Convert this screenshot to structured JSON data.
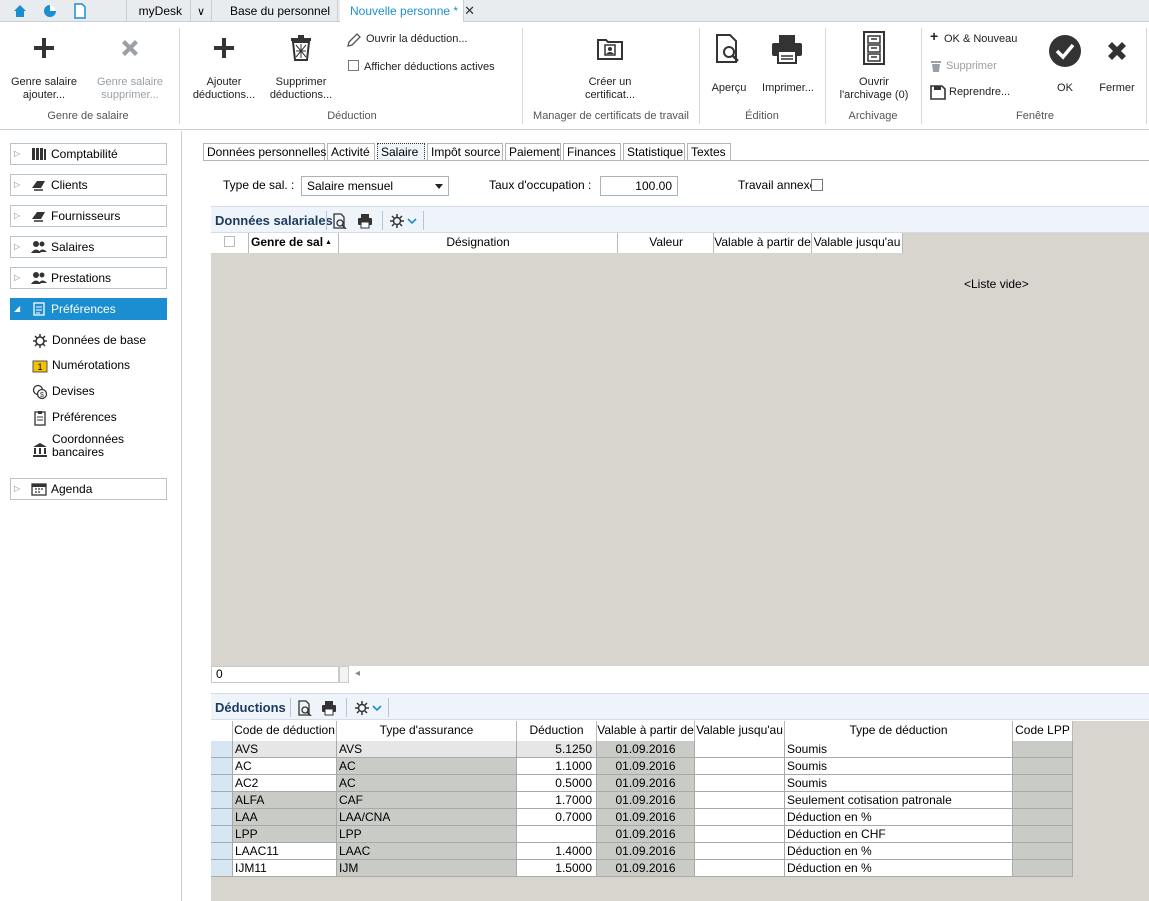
{
  "tabs": {
    "mydesk": "myDesk",
    "base": "Base du personnel",
    "active": "Nouvelle personne *"
  },
  "ribbon": {
    "genre_ajouter": [
      "Genre salaire",
      "ajouter..."
    ],
    "genre_supprimer": [
      "Genre salaire",
      "supprimer..."
    ],
    "group_genre": "Genre de salaire",
    "ajouter_deductions": [
      "Ajouter",
      "déductions..."
    ],
    "supprimer_deductions": [
      "Supprimer",
      "déductions..."
    ],
    "ouvrir_deduction": "Ouvrir la déduction...",
    "afficher_deductions": "Afficher déductions actives",
    "group_deduction": "Déduction",
    "creer_certificat": [
      "Créer un",
      "certificat..."
    ],
    "group_manager": "Manager de certificats de travail",
    "apercu": "Aperçu",
    "imprimer": "Imprimer...",
    "group_edition": "Édition",
    "ouvrir_archivage": [
      "Ouvrir",
      "l'archivage  (0)"
    ],
    "group_archivage": "Archivage",
    "ok_nouveau": "OK & Nouveau",
    "supprimer": "Supprimer",
    "reprendre": "Reprendre...",
    "ok": "OK",
    "fermer": "Fermer",
    "group_fenetre": "Fenêtre"
  },
  "sidebar": {
    "items": [
      {
        "label": "Comptabilité"
      },
      {
        "label": "Clients"
      },
      {
        "label": "Fournisseurs"
      },
      {
        "label": "Salaires"
      },
      {
        "label": "Prestations"
      },
      {
        "label": "Préférences"
      },
      {
        "label": "Agenda"
      }
    ],
    "sub": [
      {
        "label": "Données de base"
      },
      {
        "label": "Numérotations"
      },
      {
        "label": "Devises"
      },
      {
        "label": "Préférences"
      },
      {
        "label": "Coordonnées",
        "label2": "bancaires"
      }
    ]
  },
  "doc_tabs": [
    "Données personnelles",
    "Activité",
    "Salaire",
    "Impôt source",
    "Paiement",
    "Finances",
    "Statistique",
    "Textes"
  ],
  "form": {
    "type_sal_label": "Type de sal. :",
    "type_sal_value": "Salaire mensuel",
    "taux_label": "Taux d'occupation :",
    "taux_value": "100.00",
    "travail_label": "Travail annexe :"
  },
  "salariales": {
    "title": "Données salariales",
    "columns": [
      "Genre de sal",
      "Désignation",
      "Valeur",
      "Valable à partir de",
      "Valable jusqu'au"
    ],
    "empty": "<Liste vide>",
    "count": "0"
  },
  "deductions": {
    "title": "Déductions",
    "columns": [
      "Code de déduction",
      "Type d'assurance",
      "Déduction",
      "Valable à partir de",
      "Valable jusqu'au",
      "Type de déduction",
      "Code LPP"
    ],
    "rows": [
      {
        "code": "AVS",
        "type": "AVS",
        "ded": "5.1250",
        "from": "01.09.2016",
        "to": "",
        "kind": "Soumis",
        "lpp": ""
      },
      {
        "code": "AC",
        "type": "AC",
        "ded": "1.1000",
        "from": "01.09.2016",
        "to": "",
        "kind": "Soumis",
        "lpp": ""
      },
      {
        "code": "AC2",
        "type": "AC",
        "ded": "0.5000",
        "from": "01.09.2016",
        "to": "",
        "kind": "Soumis",
        "lpp": ""
      },
      {
        "code": "ALFA",
        "type": "CAF",
        "ded": "1.7000",
        "from": "01.09.2016",
        "to": "",
        "kind": "Seulement cotisation patronale",
        "lpp": ""
      },
      {
        "code": "LAA",
        "type": "LAA/CNA",
        "ded": "0.7000",
        "from": "01.09.2016",
        "to": "",
        "kind": "Déduction en %",
        "lpp": ""
      },
      {
        "code": "LPP",
        "type": "LPP",
        "ded": "",
        "from": "01.09.2016",
        "to": "",
        "kind": "Déduction en CHF",
        "lpp": ""
      },
      {
        "code": "LAAC11",
        "type": "LAAC",
        "ded": "1.4000",
        "from": "01.09.2016",
        "to": "",
        "kind": "Déduction en %",
        "lpp": ""
      },
      {
        "code": "IJM11",
        "type": "IJM",
        "ded": "1.5000",
        "from": "01.09.2016",
        "to": "",
        "kind": "Déduction en %",
        "lpp": ""
      }
    ]
  },
  "colors": {
    "accent": "#1b8ed1",
    "header_text": "#1d3a5f",
    "grid_bg": "#d8d4ce"
  }
}
